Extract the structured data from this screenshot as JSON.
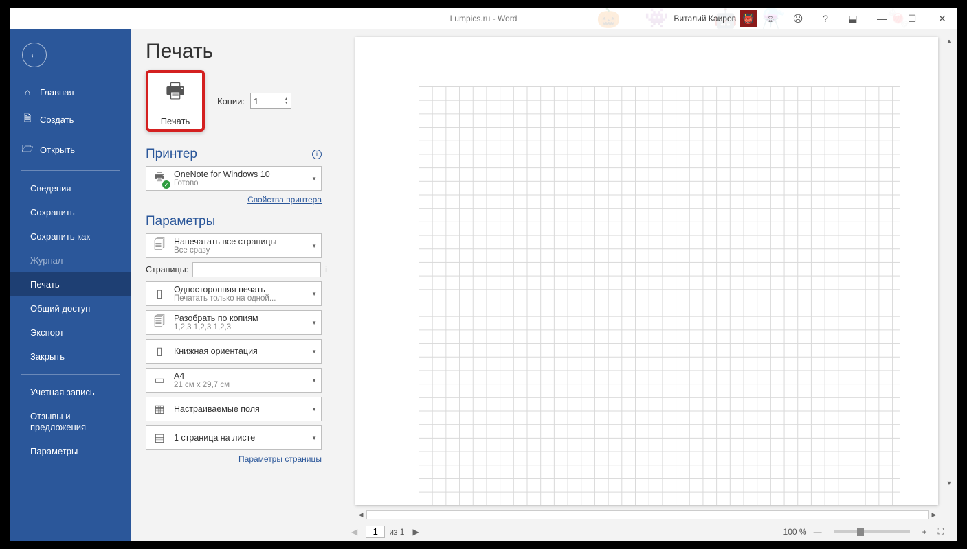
{
  "title": "Lumpics.ru  -  Word",
  "user": "Виталий Каиров",
  "sidebar": {
    "home": "Главная",
    "new": "Создать",
    "open": "Открыть",
    "info": "Сведения",
    "save": "Сохранить",
    "saveas": "Сохранить как",
    "history": "Журнал",
    "print": "Печать",
    "share": "Общий доступ",
    "export": "Экспорт",
    "close": "Закрыть",
    "account": "Учетная запись",
    "feedback": "Отзывы и предложения",
    "options": "Параметры"
  },
  "page": {
    "heading": "Печать",
    "print_label": "Печать",
    "copies_label": "Копии:",
    "copies_value": "1",
    "printer_heading": "Принтер",
    "printer_name": "OneNote for Windows 10",
    "printer_status": "Готово",
    "printer_props": "Свойства принтера",
    "settings_heading": "Параметры",
    "opt_allpages_t": "Напечатать все страницы",
    "opt_allpages_s": "Все сразу",
    "pages_label": "Страницы:",
    "opt_side_t": "Односторонняя печать",
    "opt_side_s": "Печатать только на одной...",
    "opt_collate_t": "Разобрать по копиям",
    "opt_collate_s": "1,2,3    1,2,3    1,2,3",
    "opt_orient_t": "Книжная ориентация",
    "opt_paper_t": "A4",
    "opt_paper_s": "21 см x 29,7 см",
    "opt_margins_t": "Настраиваемые поля",
    "opt_ppp_t": "1 страница на листе",
    "page_setup": "Параметры страницы"
  },
  "status": {
    "page_current": "1",
    "page_of": "из 1",
    "zoom": "100 %"
  }
}
